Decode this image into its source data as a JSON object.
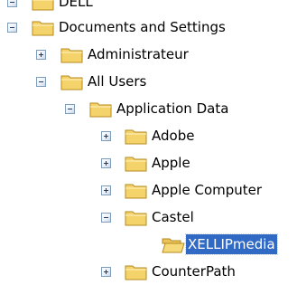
{
  "tree": {
    "nodes": [
      {
        "label": "DELL",
        "state": "expanded",
        "selected": false
      },
      {
        "label": "Documents and Settings",
        "state": "expanded",
        "selected": false
      },
      {
        "label": "Administrateur",
        "state": "collapsed",
        "selected": false
      },
      {
        "label": "All Users",
        "state": "expanded",
        "selected": false
      },
      {
        "label": "Application Data",
        "state": "expanded",
        "selected": false
      },
      {
        "label": "Adobe",
        "state": "collapsed",
        "selected": false
      },
      {
        "label": "Apple",
        "state": "collapsed",
        "selected": false
      },
      {
        "label": "Apple Computer",
        "state": "collapsed",
        "selected": false
      },
      {
        "label": "Castel",
        "state": "expanded",
        "selected": false
      },
      {
        "label": "XELLIPmedia",
        "state": "leaf",
        "selected": true
      },
      {
        "label": "CounterPath",
        "state": "collapsed",
        "selected": false
      }
    ]
  },
  "colors": {
    "selection": "#316ac5",
    "selection_text": "#ffffff",
    "folder_body": "#f4d36b",
    "folder_border": "#b68a1d"
  }
}
